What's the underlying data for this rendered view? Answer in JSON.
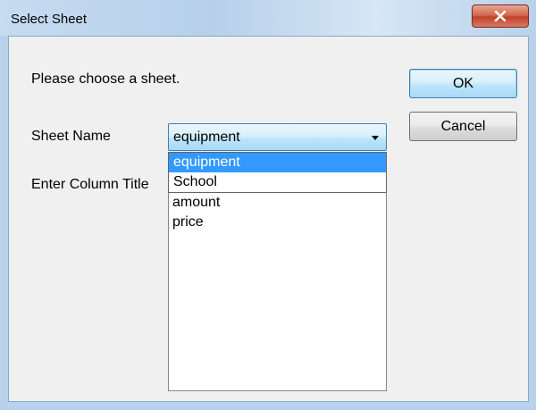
{
  "window": {
    "title": "Select Sheet",
    "close_icon": "close-icon"
  },
  "dialog": {
    "prompt": "Please choose a sheet.",
    "sheet_name_label": "Sheet Name",
    "column_title_label": "Enter Column Title",
    "ok_label": "OK",
    "cancel_label": "Cancel"
  },
  "sheet_combo": {
    "selected": "equipment",
    "options": [
      "equipment",
      "School"
    ],
    "highlighted_option": "equipment"
  },
  "column_list": {
    "items": [
      "amount",
      "price"
    ]
  },
  "colors": {
    "selection": "#3399ff",
    "close_button": "#c2402a"
  }
}
